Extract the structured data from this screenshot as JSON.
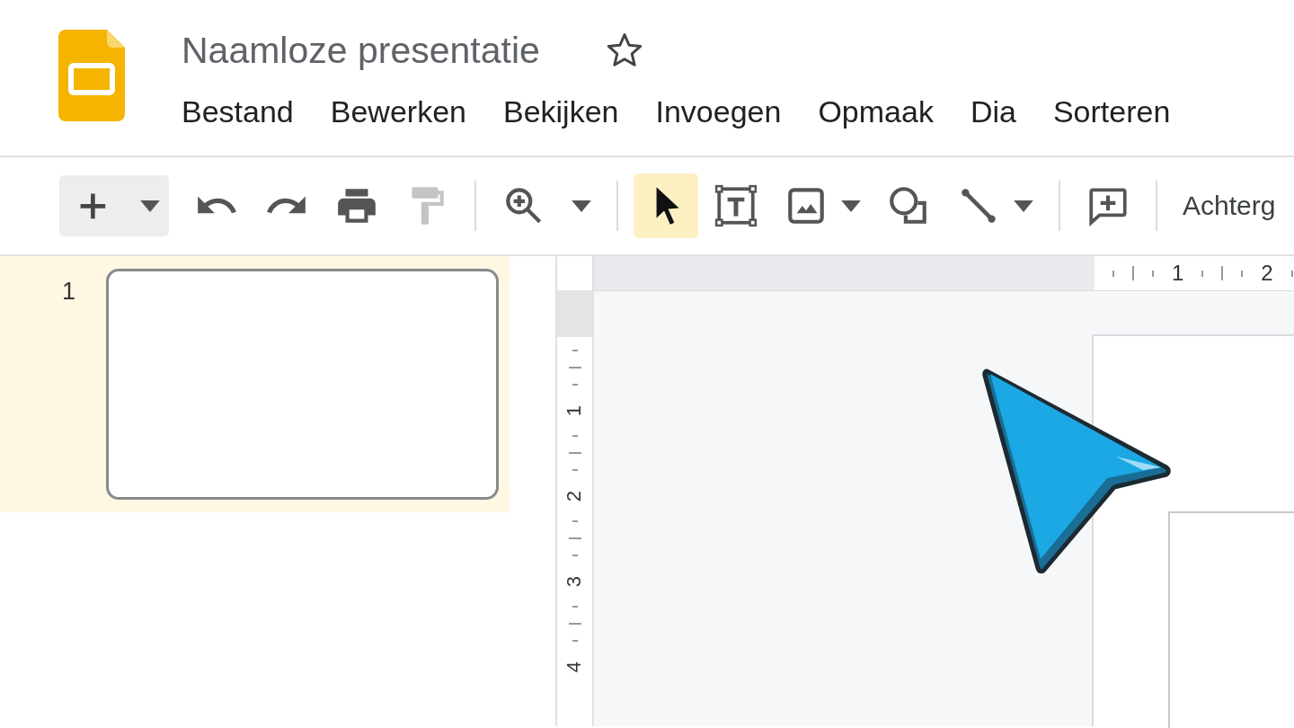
{
  "document": {
    "title": "Naamloze presentatie",
    "starred": false
  },
  "menu": [
    {
      "label": "Bestand"
    },
    {
      "label": "Bewerken"
    },
    {
      "label": "Bekijken"
    },
    {
      "label": "Invoegen"
    },
    {
      "label": "Opmaak"
    },
    {
      "label": "Dia"
    },
    {
      "label": "Sorteren"
    }
  ],
  "toolbar": {
    "paint_format": {
      "disabled": true
    },
    "tools": [
      {
        "kind": "select",
        "selected": true
      },
      {
        "kind": "textbox",
        "selected": false
      },
      {
        "kind": "image",
        "selected": false
      },
      {
        "kind": "shape",
        "selected": false
      },
      {
        "kind": "line",
        "selected": false
      }
    ],
    "background_label": "Achterg"
  },
  "slides": [
    {
      "number": "1",
      "selected": true
    }
  ],
  "rulers": {
    "horizontal": [
      "1",
      "2"
    ],
    "vertical": [
      "1",
      "2",
      "3",
      "4"
    ]
  }
}
